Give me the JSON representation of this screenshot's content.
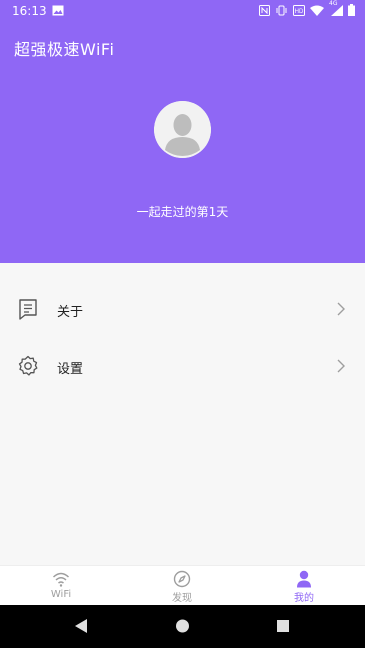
{
  "status_bar": {
    "time": "16:13",
    "network_label": "4G",
    "icons": [
      "image-icon",
      "nfc-icon",
      "vibrate-icon",
      "hd-icon",
      "wifi-icon",
      "signal-icon",
      "battery-icon"
    ]
  },
  "app": {
    "title": "超强极速WiFi"
  },
  "profile": {
    "tagline": "一起走过的第1天"
  },
  "menu": {
    "items": [
      {
        "label": "关于",
        "icon": "document-icon"
      },
      {
        "label": "设置",
        "icon": "gear-icon"
      }
    ]
  },
  "tabs": [
    {
      "label": "WiFi",
      "icon": "wifi-icon",
      "active": false
    },
    {
      "label": "发现",
      "icon": "compass-icon",
      "active": false
    },
    {
      "label": "我的",
      "icon": "person-icon",
      "active": true
    }
  ],
  "colors": {
    "primary": "#8f67f5",
    "tab_inactive": "#9e9e9e",
    "tab_active": "#8f67f5"
  },
  "system_nav": [
    "back-button",
    "home-button",
    "recents-button"
  ]
}
